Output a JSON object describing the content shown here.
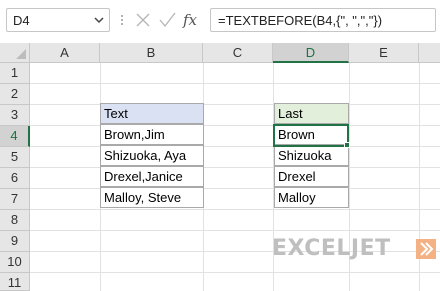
{
  "name_box": {
    "value": "D4"
  },
  "formula_bar": {
    "formula": "=TEXTBEFORE(B4,{\", \",\",\"})",
    "cancel_icon": "cancel-x-icon",
    "enter_icon": "enter-check-icon",
    "fx_icon": "function-fx-icon"
  },
  "columns": [
    "A",
    "B",
    "C",
    "D",
    "E"
  ],
  "active_column": "D",
  "rows": [
    "1",
    "2",
    "3",
    "4",
    "5",
    "6",
    "7",
    "8",
    "9",
    "10",
    "11"
  ],
  "active_row": "4",
  "source_table": {
    "header": "Text",
    "values": [
      "Brown,Jim",
      "Shizuoka, Aya",
      "Drexel,Janice",
      "Malloy, Steve"
    ]
  },
  "result_table": {
    "header": "Last",
    "values": [
      "Brown",
      "Shizuoka",
      "Drexel",
      "Malloy"
    ]
  },
  "logo": {
    "text": "EXCELJET"
  },
  "colors": {
    "accent": "#217346",
    "header_blue": "#d9e1f2",
    "header_green": "#e2efda"
  }
}
